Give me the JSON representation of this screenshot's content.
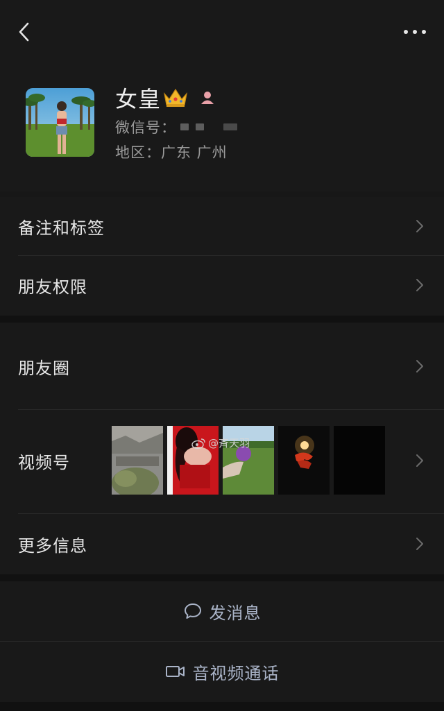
{
  "profile": {
    "name": "女皇",
    "wechat_id_label": "微信号：",
    "region": "地区：广东 广州"
  },
  "menu": {
    "remark_tags": "备注和标签",
    "friend_permissions": "朋友权限",
    "moments": "朋友圈",
    "channels": "视频号",
    "more_info": "更多信息"
  },
  "watermark": "@斉天羽",
  "actions": {
    "send_message": "发消息",
    "av_call": "音视频通话"
  },
  "colors": {
    "background": "#191919",
    "action_text": "#aab4c8",
    "gender_female": "#e8a0a8"
  },
  "icons": {
    "back": "chevron-left-icon",
    "more": "more-dots-icon",
    "crown": "crown-icon",
    "gender": "female-icon",
    "row_arrow": "chevron-right-icon",
    "message": "chat-bubble-icon",
    "video": "video-camera-icon",
    "weibo": "weibo-icon"
  }
}
